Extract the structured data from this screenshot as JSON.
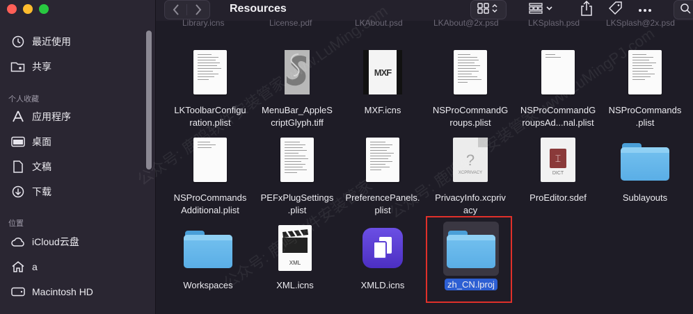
{
  "window": {
    "title": "Resources"
  },
  "sidebar": {
    "items_top": [
      {
        "label": "最近使用",
        "icon": "clock-icon"
      },
      {
        "label": "共享",
        "icon": "shared-folder-icon"
      }
    ],
    "favorites_header": "个人收藏",
    "favorites": [
      {
        "label": "应用程序",
        "icon": "applications-icon"
      },
      {
        "label": "桌面",
        "icon": "desktop-icon"
      },
      {
        "label": "文稿",
        "icon": "document-icon"
      },
      {
        "label": "下载",
        "icon": "download-icon"
      }
    ],
    "locations_header": "位置",
    "locations": [
      {
        "label": "iCloud云盘",
        "icon": "cloud-icon"
      },
      {
        "label": "a",
        "icon": "home-icon"
      },
      {
        "label": "Macintosh HD",
        "icon": "disk-icon"
      }
    ]
  },
  "toolbar": {
    "back_icon": "chevron-left-icon",
    "forward_icon": "chevron-right-icon",
    "view_icon": "grid-view-icon",
    "group_icon": "group-icon",
    "share_icon": "share-icon",
    "tag_icon": "tag-icon",
    "more_icon": "ellipsis-icon",
    "search_icon": "search-icon"
  },
  "partial_row": [
    "Library.icns",
    "License.pdf",
    "LKAbout.psd",
    "LKAbout@2x.psd",
    "LKSplash.psd",
    "LKSplash@2x.psd"
  ],
  "files": [
    {
      "name1": "LKToolbarConfigu",
      "name2": "ration.plist",
      "kind": "plist"
    },
    {
      "name1": "MenuBar_AppleS",
      "name2": "criptGlyph.tiff",
      "kind": "tiff"
    },
    {
      "name1": "MXF.icns",
      "name2": "",
      "kind": "mxf"
    },
    {
      "name1": "NSProCommandG",
      "name2": "roups.plist",
      "kind": "plist"
    },
    {
      "name1": "NSProCommandG",
      "name2": "roupsAd...nal.plist",
      "kind": "plist-blank"
    },
    {
      "name1": "NSProCommands",
      "name2": ".plist",
      "kind": "plist"
    },
    {
      "name1": "NSProCommands",
      "name2": "Additional.plist",
      "kind": "plist-blank"
    },
    {
      "name1": "PEFxPlugSettings",
      "name2": ".plist",
      "kind": "plist"
    },
    {
      "name1": "PreferencePanels.",
      "name2": "plist",
      "kind": "plist"
    },
    {
      "name1": "PrivacyInfo.xcpriv",
      "name2": "acy",
      "kind": "xcprivacy"
    },
    {
      "name1": "ProEditor.sdef",
      "name2": "",
      "kind": "sdef"
    },
    {
      "name1": "Sublayouts",
      "name2": "",
      "kind": "folder"
    },
    {
      "name1": "Workspaces",
      "name2": "",
      "kind": "folder"
    },
    {
      "name1": "XML.icns",
      "name2": "",
      "kind": "xml"
    },
    {
      "name1": "XMLD.icns",
      "name2": "",
      "kind": "xmld"
    },
    {
      "name1": "zh_CN.lproj",
      "name2": "",
      "kind": "folder-selected"
    }
  ],
  "icon_text": {
    "mxf": "MXF",
    "xcprivacy": "XCPRIVACY",
    "dict": "DICT",
    "xml": "XML",
    "question": "?"
  },
  "colors": {
    "selection": "#2d5fd3",
    "highlight_box": "#e0302a",
    "folder": "#64b5ec"
  }
}
